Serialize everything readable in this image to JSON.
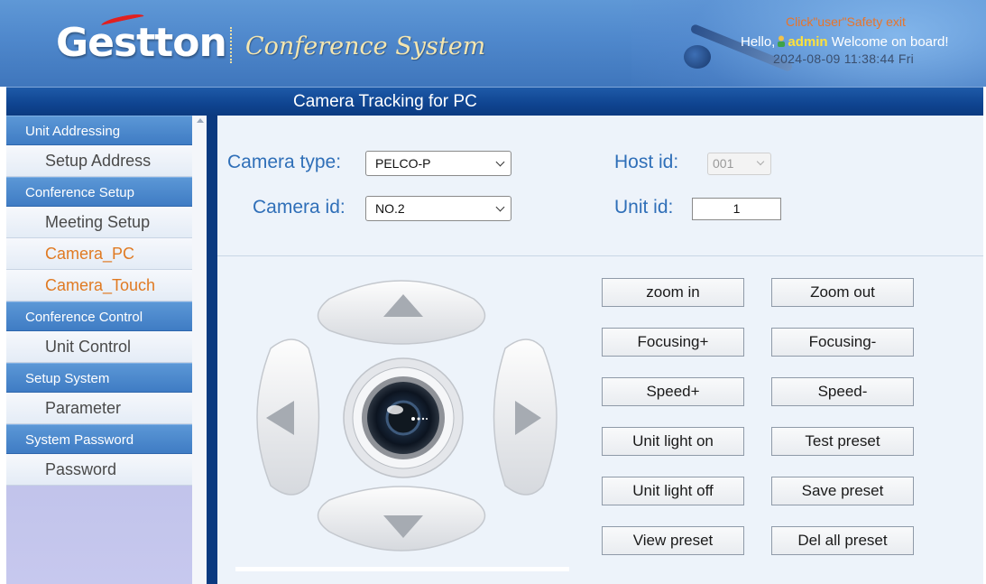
{
  "header": {
    "logo_text": "Gestton",
    "subtitle": "Conference System",
    "safety_exit": "Click\"user\"Safety exit",
    "welcome_prefix": "Hello,",
    "username": "admin",
    "welcome_suffix": "Welcome on board!",
    "datetime": "2024-08-09 11:38:44 Fri"
  },
  "page_title": "Camera Tracking for PC",
  "sidebar": {
    "groups": [
      {
        "label": "Unit Addressing",
        "items": [
          {
            "label": "Setup Address"
          }
        ]
      },
      {
        "label": "Conference Setup",
        "items": [
          {
            "label": "Meeting Setup"
          },
          {
            "label": "Camera_PC",
            "active": true
          },
          {
            "label": "Camera_Touch",
            "active": true
          }
        ]
      },
      {
        "label": "Conference Control",
        "items": [
          {
            "label": "Unit Control"
          }
        ]
      },
      {
        "label": "Setup System",
        "items": [
          {
            "label": "Parameter"
          }
        ]
      },
      {
        "label": "System Password",
        "items": [
          {
            "label": "Password"
          }
        ]
      }
    ]
  },
  "form": {
    "camera_type_label": "Camera type:",
    "camera_type_value": "PELCO-P",
    "camera_id_label": "Camera id:",
    "camera_id_value": "NO.2",
    "host_id_label": "Host id:",
    "host_id_value": "001",
    "unit_id_label": "Unit id:",
    "unit_id_value": "1"
  },
  "controls": {
    "zoom_in": "zoom in",
    "zoom_out": "Zoom out",
    "focusing_plus": "Focusing+",
    "focusing_minus": "Focusing-",
    "speed_plus": "Speed+",
    "speed_minus": "Speed-",
    "unit_light_on": "Unit light on",
    "test_preset": "Test preset",
    "unit_light_off": "Unit light off",
    "save_preset": "Save preset",
    "view_preset": "View preset",
    "del_all_preset": "Del all preset"
  },
  "icons": {
    "pad_up": "arrow-up-icon",
    "pad_down": "arrow-down-icon",
    "pad_left": "arrow-left-icon",
    "pad_right": "arrow-right-icon",
    "camera_lens": "camera-lens-icon",
    "user": "user-icon"
  },
  "colors": {
    "header_blue": "#4f88cc",
    "title_bar": "#0f4490",
    "label_blue": "#2f6fb8",
    "active_menu": "#e07a22",
    "admin_yellow": "#ffe23a"
  }
}
